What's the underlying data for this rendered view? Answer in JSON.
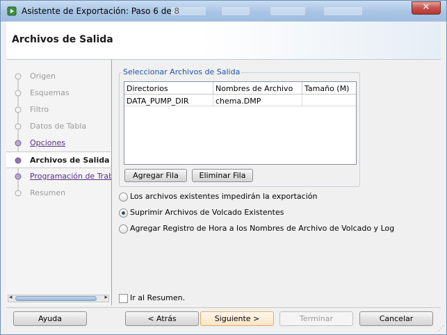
{
  "window": {
    "title": "Asistente de Exportación: Paso 6 de 8",
    "close_label": "✕"
  },
  "header": {
    "title": "Archivos de Salida"
  },
  "nav": {
    "items": [
      {
        "label": "Origen",
        "state": "disabled"
      },
      {
        "label": "Esquemas",
        "state": "disabled"
      },
      {
        "label": "Filtro",
        "state": "disabled"
      },
      {
        "label": "Datos de Tabla",
        "state": "disabled"
      },
      {
        "label": "Opciones",
        "state": "link"
      },
      {
        "label": "Archivos de Salida",
        "state": "active"
      },
      {
        "label": "Programación de Trabajo",
        "state": "link"
      },
      {
        "label": "Resumen",
        "state": "disabled"
      }
    ]
  },
  "files_group": {
    "legend": "Seleccionar Archivos de Salida",
    "columns": [
      "Directorios",
      "Nombres de Archivo",
      "Tamaño (M)"
    ],
    "rows": [
      [
        "DATA_PUMP_DIR",
        "chema.DMP",
        ""
      ]
    ],
    "add_row_label": "Agregar Fila",
    "delete_row_label": "Eliminar Fila"
  },
  "options": {
    "radio_1": "Los archivos existentes impedirán la exportación",
    "radio_2": "Suprimir Archivos de Volcado Existentes",
    "radio_3": "Agregar Registro de Hora a los Nombres de Archivo de Volcado y Log",
    "selected": 2
  },
  "go_summary_label": "Ir al Resumen.",
  "buttons": {
    "help": "Ayuda",
    "back": "< Atrás",
    "next": "Siguiente >",
    "finish": "Terminar",
    "cancel": "Cancelar"
  }
}
